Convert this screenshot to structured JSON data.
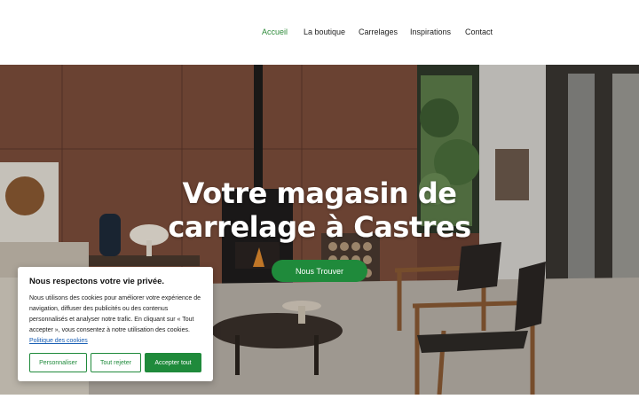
{
  "nav": {
    "items": [
      {
        "label": "Accueil",
        "active": true
      },
      {
        "label": "La boutique",
        "active": false
      },
      {
        "label": "Carrelages",
        "active": false
      },
      {
        "label": "Inspirations",
        "active": false
      },
      {
        "label": "Contact",
        "active": false
      }
    ]
  },
  "hero": {
    "title": "Votre magasin de carrelage à Castres",
    "cta_label": "Nous Trouver"
  },
  "cookie": {
    "title": "Nous respectons votre vie privée.",
    "text": "Nous utilisons des cookies pour améliorer votre expérience de navigation, diffuser des publicités ou des contenus personnalisés et analyser notre trafic. En cliquant sur « Tout accepter », vous consentez à notre utilisation des cookies.",
    "policy_link": "Politique des cookies",
    "buttons": {
      "customize": "Personnaliser",
      "reject": "Tout rejeter",
      "accept": "Accepter tout"
    }
  },
  "colors": {
    "accent": "#1f8a3b",
    "active_nav": "#2e8b3a",
    "link": "#1a5fb4"
  }
}
